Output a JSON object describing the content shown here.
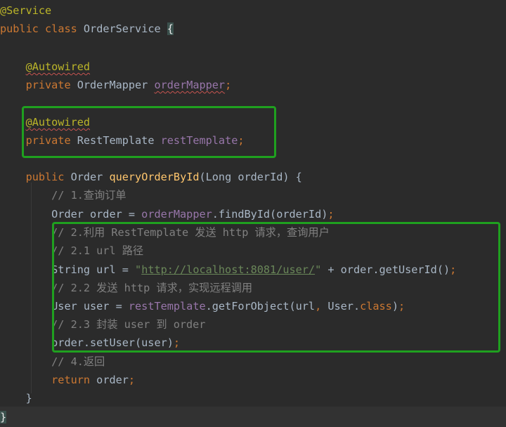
{
  "code": {
    "l1": {
      "ann": "@Service"
    },
    "l2": {
      "kw1": "public",
      "kw2": "class",
      "name": "OrderService",
      "brace": "{"
    },
    "l4": {
      "ann": "@Autowired"
    },
    "l5": {
      "kw": "private",
      "type": "OrderMapper",
      "field": "orderMapper",
      "semi": ";"
    },
    "l7": {
      "ann": "@Autowired"
    },
    "l8": {
      "kw": "private",
      "type": "RestTemplate",
      "field": "restTemplate",
      "semi": ";"
    },
    "l10": {
      "kw": "public",
      "type": "Order",
      "method": "queryOrderById",
      "open": "(Long orderId) {"
    },
    "l11": {
      "cmt": "// 1.查询订单"
    },
    "l12": {
      "pre": "Order order = ",
      "field": "orderMapper",
      "post": ".findById(orderId)",
      "semi": ";"
    },
    "l13": {
      "cmt": "// 2.利用 RestTemplate 发送 http 请求，查询用户"
    },
    "l14": {
      "cmt": "// 2.1 url 路径"
    },
    "l15": {
      "pre": "String url = ",
      "q1": "\"",
      "url": "http://localhost:8081/user/",
      "q2": "\"",
      "post": " + order.getUserId()",
      "semi": ";"
    },
    "l16": {
      "cmt": "// 2.2 发送 http 请求，实现远程调用"
    },
    "l17": {
      "pre": "User user = ",
      "field": "restTemplate",
      "post": ".getForObject(url",
      "comma": ",",
      "post2": " User.",
      "kw": "class",
      "close": ")",
      "semi": ";"
    },
    "l18": {
      "cmt": "// 2.3 封装 user 到 order"
    },
    "l19": {
      "pre": "order.setUser(user)",
      "semi": ";"
    },
    "l20": {
      "cmt": "// 4.返回"
    },
    "l21": {
      "kw": "return",
      "post": " order",
      "semi": ";"
    },
    "l22": {
      "brace": "}"
    },
    "l23": {
      "brace": "}"
    }
  },
  "colors": {
    "background": "#2b2b2b",
    "keyword": "#cc7832",
    "annotation": "#bbb529",
    "field": "#9876aa",
    "method": "#ffc66d",
    "comment": "#808080",
    "string": "#6a8759",
    "highlight_box": "#1fa01f"
  }
}
